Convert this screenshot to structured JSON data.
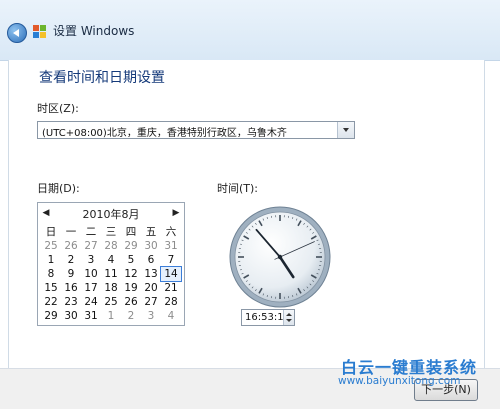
{
  "window": {
    "title": "设置 Windows"
  },
  "main": {
    "page_title": "查看时间和日期设置",
    "timezone_label": "时区(Z):",
    "timezone_value": "(UTC+08:00)北京，重庆，香港特别行政区，乌鲁木齐",
    "date_label": "日期(D):",
    "time_label": "时间(T):"
  },
  "calendar": {
    "month_title": "2010年8月",
    "prev": "◀",
    "next": "▶",
    "weekdays": [
      "日",
      "一",
      "二",
      "三",
      "四",
      "五",
      "六"
    ],
    "weeks": [
      [
        [
          "25",
          true
        ],
        [
          "26",
          true
        ],
        [
          "27",
          true
        ],
        [
          "28",
          true
        ],
        [
          "29",
          true
        ],
        [
          "30",
          true
        ],
        [
          "31",
          true
        ]
      ],
      [
        [
          "1",
          false
        ],
        [
          "2",
          false
        ],
        [
          "3",
          false
        ],
        [
          "4",
          false
        ],
        [
          "5",
          false
        ],
        [
          "6",
          false
        ],
        [
          "7",
          false
        ]
      ],
      [
        [
          "8",
          false
        ],
        [
          "9",
          false
        ],
        [
          "10",
          false
        ],
        [
          "11",
          false
        ],
        [
          "12",
          false
        ],
        [
          "13",
          false
        ],
        [
          "14",
          false
        ]
      ],
      [
        [
          "15",
          false
        ],
        [
          "16",
          false
        ],
        [
          "17",
          false
        ],
        [
          "18",
          false
        ],
        [
          "19",
          false
        ],
        [
          "20",
          false
        ],
        [
          "21",
          false
        ]
      ],
      [
        [
          "22",
          false
        ],
        [
          "23",
          false
        ],
        [
          "24",
          false
        ],
        [
          "25",
          false
        ],
        [
          "26",
          false
        ],
        [
          "27",
          false
        ],
        [
          "28",
          false
        ]
      ],
      [
        [
          "29",
          false
        ],
        [
          "30",
          false
        ],
        [
          "31",
          false
        ],
        [
          "1",
          true
        ],
        [
          "2",
          true
        ],
        [
          "3",
          true
        ],
        [
          "4",
          true
        ]
      ]
    ],
    "selected_day": "14"
  },
  "clock": {
    "hours": 16,
    "minutes": 53,
    "seconds": 11
  },
  "time_field": {
    "value": "16:53:11"
  },
  "footer": {
    "next_label": "下一步(N)"
  },
  "watermark": {
    "line1": "白云一键重装系统",
    "line2": "www.baiyunxitong.com"
  },
  "colors": {
    "accent": "#2e6fb9",
    "title_blue": "#153a7a",
    "watermark": "#2a7cd0"
  }
}
